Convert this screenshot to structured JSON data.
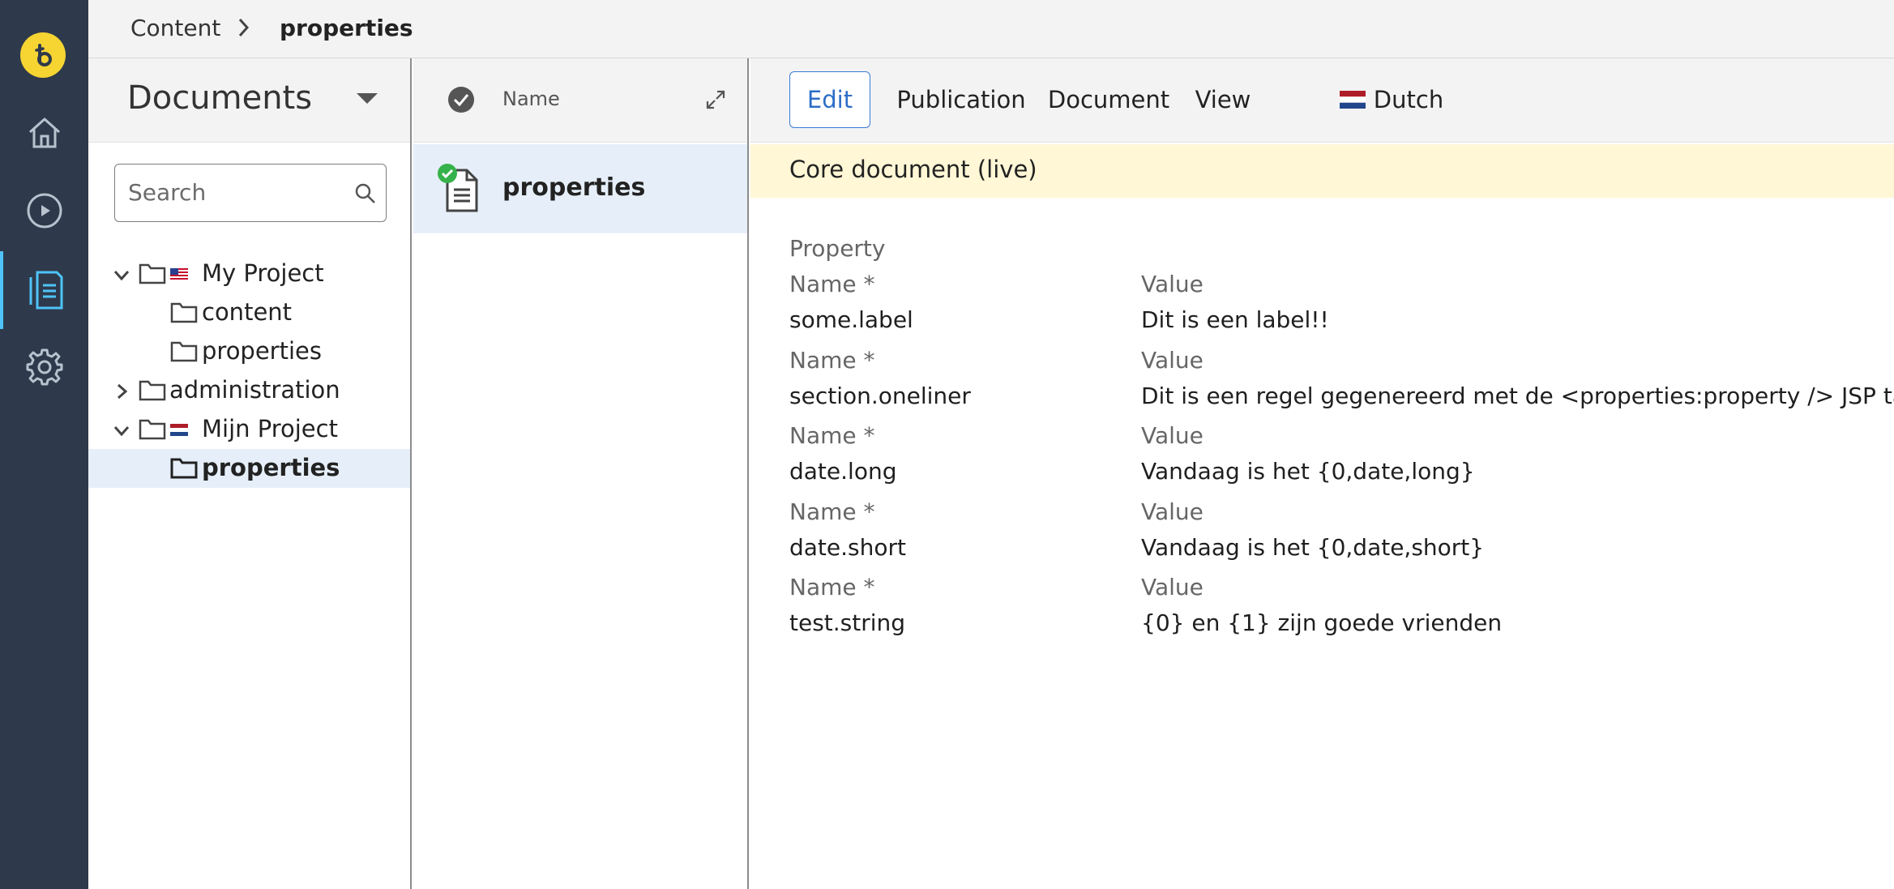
{
  "colors": {
    "rail_bg": "#2e3a4b",
    "logo": "#f6d432",
    "accent": "#3a7bd5",
    "active_nav": "#4fc3f7",
    "selected_row": "#e6eff9",
    "banner": "#fff7d6",
    "status_ok": "#36b24a"
  },
  "rail": {
    "logo_icon": "bloomreach-logo-icon",
    "items": [
      {
        "icon": "home-icon"
      },
      {
        "icon": "play-circle-icon"
      },
      {
        "icon": "document-icon",
        "active": true
      },
      {
        "icon": "gear-icon"
      }
    ]
  },
  "breadcrumb": {
    "items": [
      "Content",
      "properties"
    ]
  },
  "tree": {
    "title": "Documents",
    "search_placeholder": "Search",
    "nodes": [
      {
        "label": "My Project",
        "expanded": true,
        "flag": "us-flag-icon",
        "level": 0
      },
      {
        "label": "content",
        "level": 1
      },
      {
        "label": "properties",
        "level": 1
      },
      {
        "label": "administration",
        "expanded": false,
        "level": 0
      },
      {
        "label": "Mijn Project",
        "expanded": true,
        "flag": "nl-flag-icon",
        "level": 0
      },
      {
        "label": "properties",
        "level": 1,
        "selected": true
      }
    ]
  },
  "list": {
    "column_name": "Name",
    "rows": [
      {
        "label": "properties",
        "status": "live"
      }
    ]
  },
  "editor": {
    "tabs": [
      "Edit",
      "Publication",
      "Document",
      "View",
      "Dutch"
    ],
    "active_tab": "Edit",
    "banner": "Core document (live)",
    "group_label": "Property",
    "name_label": "Name *",
    "value_label": "Value",
    "properties": [
      {
        "name": "some.label",
        "value": "Dit is een label!!"
      },
      {
        "name": "section.oneliner",
        "value": "Dit is een regel gegenereerd met de <properties:property /> JSP tag"
      },
      {
        "name": "date.long",
        "value": "Vandaag is het {0,date,long}"
      },
      {
        "name": "date.short",
        "value": "Vandaag is het {0,date,short}"
      },
      {
        "name": "test.string",
        "value": "{0} en {1} zijn goede vrienden"
      }
    ]
  }
}
